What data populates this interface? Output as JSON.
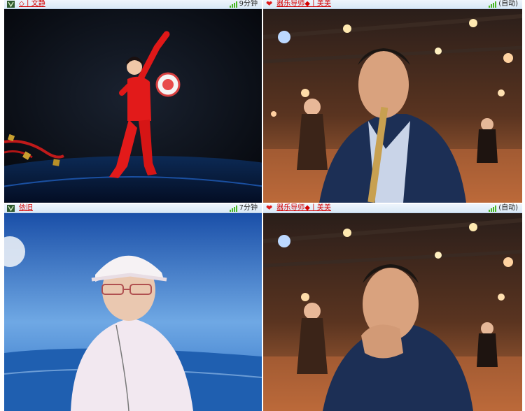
{
  "cells": [
    {
      "name": "◇丨文静",
      "status": "9分钟",
      "icon": "lily-icon"
    },
    {
      "name": "器乐导师◆丨美美",
      "status": "(自动)",
      "icon": "heart-icon"
    },
    {
      "name": "依旧",
      "status": "7分钟",
      "icon": "lily-icon"
    },
    {
      "name": "器乐导师◆丨美美",
      "status": "(自动)",
      "icon": "heart-icon"
    }
  ],
  "colors": {
    "name_red": "#d40000",
    "signal_green": "#49b823",
    "bar_bg": "#dfeaf6"
  }
}
